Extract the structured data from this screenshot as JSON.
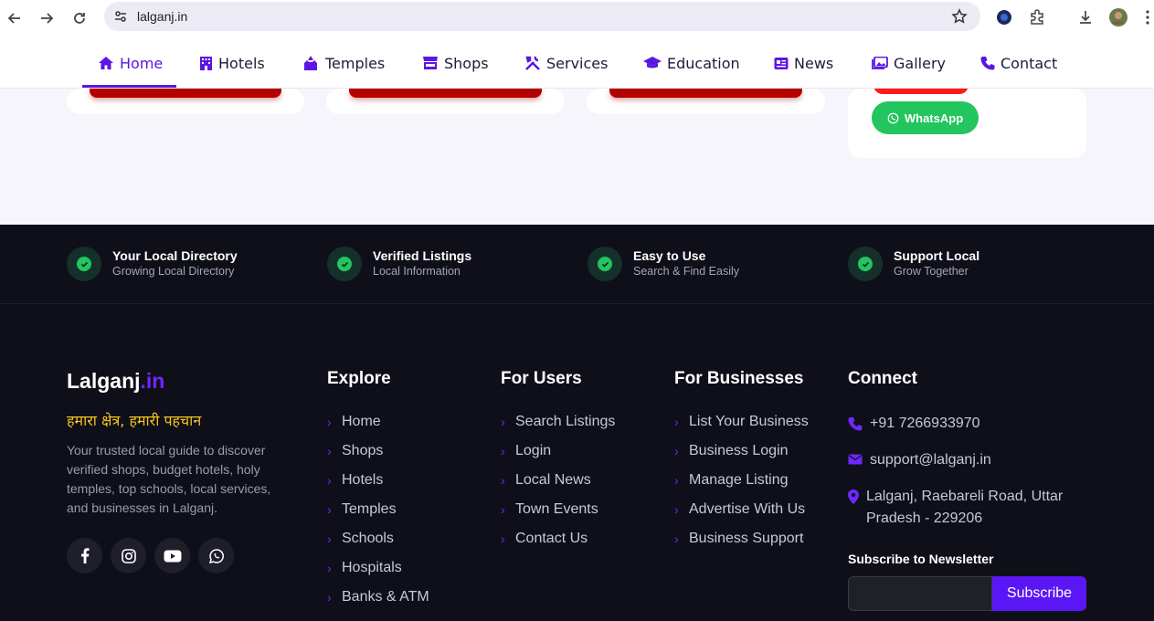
{
  "browser": {
    "url": "lalganj.in"
  },
  "nav": {
    "items": [
      {
        "label": "Home",
        "icon": "home-icon"
      },
      {
        "label": "Hotels",
        "icon": "hotel-icon"
      },
      {
        "label": "Temples",
        "icon": "temple-icon"
      },
      {
        "label": "Shops",
        "icon": "shop-icon"
      },
      {
        "label": "Services",
        "icon": "tools-icon"
      },
      {
        "label": "Education",
        "icon": "graduation-cap-icon"
      },
      {
        "label": "News",
        "icon": "newspaper-icon"
      },
      {
        "label": "Gallery",
        "icon": "images-icon"
      },
      {
        "label": "Contact",
        "icon": "phone-icon"
      }
    ],
    "active": "Home"
  },
  "sidebar_card": {
    "whatsapp_label": "WhatsApp"
  },
  "features": [
    {
      "title": "Your Local Directory",
      "subtitle": "Growing Local Directory"
    },
    {
      "title": "Verified Listings",
      "subtitle": "Local Information"
    },
    {
      "title": "Easy to Use",
      "subtitle": "Search & Find Easily"
    },
    {
      "title": "Support Local",
      "subtitle": "Grow Together"
    }
  ],
  "footer": {
    "brand_name": "Lalganj",
    "brand_tld": ".in",
    "tagline": "हमारा क्षेत्र, हमारी पहचान",
    "about": "Your trusted local guide to discover verified shops, budget hotels, holy temples, top schools, local services, and businesses in Lalganj.",
    "explore": {
      "title": "Explore",
      "links": [
        "Home",
        "Shops",
        "Hotels",
        "Temples",
        "Schools",
        "Hospitals",
        "Banks & ATM"
      ]
    },
    "users": {
      "title": "For Users",
      "links": [
        "Search Listings",
        "Login",
        "Local News",
        "Town Events",
        "Contact Us"
      ]
    },
    "businesses": {
      "title": "For Businesses",
      "links": [
        "List Your Business",
        "Business Login",
        "Manage Listing",
        "Advertise With Us",
        "Business Support"
      ]
    },
    "connect": {
      "title": "Connect",
      "phone": "+91 7266933970",
      "email": "support@lalganj.in",
      "address_line1": "Lalganj, Raebareli Road, Uttar",
      "address_line2": "Pradesh - 229206"
    },
    "newsletter": {
      "title": "Subscribe to Newsletter",
      "placeholder": "",
      "button": "Subscribe"
    }
  },
  "colors": {
    "accent": "#5b16e5",
    "footer_bg": "#0f0f1a",
    "whatsapp": "#22c55e",
    "tagline": "#f5c518"
  }
}
